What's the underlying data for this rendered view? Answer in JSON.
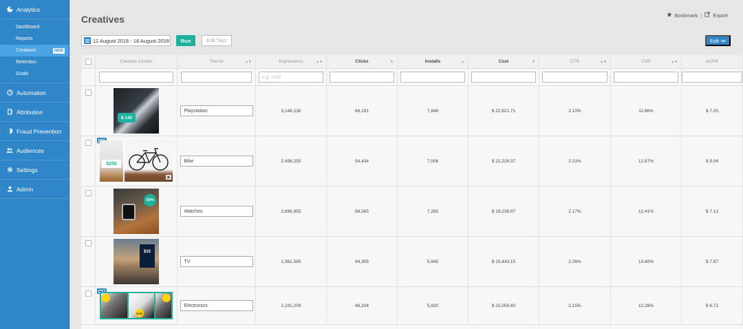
{
  "sidebar": {
    "sections": [
      {
        "label": "Analytics",
        "icon": "pie-chart-icon"
      },
      {
        "label": "Automation",
        "icon": "clock-icon"
      },
      {
        "label": "Attribution",
        "icon": "attribution-icon"
      },
      {
        "label": "Fraud Prevention",
        "icon": "shield-icon"
      },
      {
        "label": "Audiences",
        "icon": "users-icon"
      },
      {
        "label": "Settings",
        "icon": "gear-icon"
      },
      {
        "label": "Admin",
        "icon": "user-icon"
      }
    ],
    "analytics_items": [
      {
        "label": "Dashboard"
      },
      {
        "label": "Reports"
      },
      {
        "label": "Creatives",
        "active": true,
        "badge": "NEW"
      },
      {
        "label": "Retention"
      },
      {
        "label": "Goals"
      }
    ],
    "accent_color": "#2f86c8"
  },
  "header": {
    "title": "Creatives",
    "bookmark_label": "Bookmark",
    "separator": "|",
    "export_label": "Export"
  },
  "toolbar": {
    "date_range": "12 August 2018 - 18 August 2018",
    "run_label": "Run",
    "edit_tags_label": "Edit Tags",
    "edit_label": "Edit"
  },
  "table": {
    "columns": [
      {
        "label": "Creative Cluster",
        "bold": false,
        "sortable": false
      },
      {
        "label": "Theme",
        "bold": false,
        "sortable": true
      },
      {
        "label": "Impressions",
        "bold": false,
        "sortable": true
      },
      {
        "label": "Clicks",
        "bold": true,
        "sortable": true
      },
      {
        "label": "Installs",
        "bold": true,
        "sortable": true
      },
      {
        "label": "Cost",
        "bold": true,
        "sortable": true
      },
      {
        "label": "CTR",
        "bold": false,
        "sortable": true
      },
      {
        "label": "CVR",
        "bold": false,
        "sortable": true
      },
      {
        "label": "eCPM",
        "bold": false,
        "sortable": false
      }
    ],
    "filter_placeholder": "e.g. <100",
    "rows": [
      {
        "theme": "Playstation",
        "impressions": "3,148,238",
        "clicks": "66,191",
        "installs": "7,848",
        "cost": "$ 22,821.71",
        "ctr": "2.10%",
        "cvr": "11.86%",
        "ecpm": "$ 7.25",
        "price_tag": "$ 140",
        "count": ""
      },
      {
        "theme": "Bike",
        "impressions": "2,458,255",
        "clicks": "54,434",
        "installs": "7,006",
        "cost": "$ 22,228.37",
        "ctr": "2.21%",
        "cvr": "12.87%",
        "ecpm": "$ 9.04",
        "price_tag": "$250",
        "count": "6"
      },
      {
        "theme": "Watches",
        "impressions": "2,696,955",
        "clicks": "58,565",
        "installs": "7,265",
        "cost": "$ 19,238.97",
        "ctr": "2.17%",
        "cvr": "12.41%",
        "ecpm": "$ 7.13",
        "price_tag": "30%",
        "count": ""
      },
      {
        "theme": "TV",
        "impressions": "1,961,585",
        "clicks": "44,355",
        "installs": "5,945",
        "cost": "$ 15,443.15",
        "ctr": "2.26%",
        "cvr": "13.40%",
        "ecpm": "$ 7.87",
        "price_tag": "$15",
        "count": ""
      },
      {
        "theme": "Electronics",
        "impressions": "2,241,209",
        "clicks": "48,204",
        "installs": "5,920",
        "cost": "$ 15,056.83",
        "ctr": "2.15%",
        "cvr": "12.28%",
        "ecpm": "$ 6.72",
        "price_tag": "$150",
        "count": "3"
      }
    ]
  }
}
